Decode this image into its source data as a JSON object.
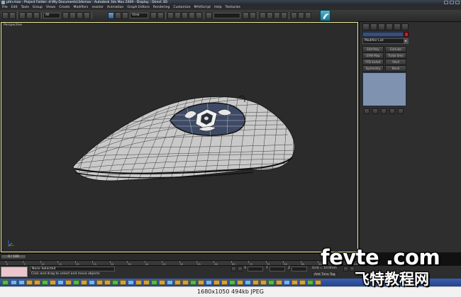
{
  "window": {
    "title": "ptin.max    - Project Folder: d:\\My Documents\\3dsmax     - Autodesk 3ds Max 2009      - Display : Direct 3D"
  },
  "menu": [
    "File",
    "Edit",
    "Tools",
    "Group",
    "Views",
    "Create",
    "Modifiers",
    "reactor",
    "Animation",
    "Graph Editors",
    "Rendering",
    "Customize",
    "MAXScript",
    "Help",
    "Tentacles"
  ],
  "toolbar": {
    "selection_filter": "All",
    "reference_coord": "View",
    "named_selection": ""
  },
  "viewport": {
    "label": "Perspective"
  },
  "command_panel": {
    "modifier_list_label": "Modifier List",
    "modifier_buttons": [
      "Edit Poly",
      "Extrude",
      "UVW Map",
      "Turbo Smo",
      "FFD 4x4x4",
      "Shell",
      "Symmetry",
      "Bend"
    ]
  },
  "timeline": {
    "slider": "0 / 100",
    "ticks": [
      "0",
      "5",
      "10",
      "15",
      "20",
      "25",
      "30",
      "35",
      "40",
      "45",
      "50",
      "55",
      "60",
      "65",
      "70",
      "75",
      "80",
      "85",
      "90",
      "95",
      "100"
    ]
  },
  "status": {
    "selection": "None Selected",
    "prompt": "Click and drag to select and move objects",
    "grid": "Grid = 10.0mm",
    "add_time_tag": "Add Time Tag",
    "x_label": "X",
    "y_label": "Y",
    "z_label": "Z"
  },
  "image_info": "1680x1050  494kb  JPEG",
  "watermark": {
    "line1": "fevte .com",
    "line2": "飞特教程网"
  },
  "colors": {
    "viewport_bg": "#2b2b2b",
    "viewport_border": "#f3f3a0",
    "object_color": "#c11e3a",
    "taskbar": "#2f52a0"
  }
}
